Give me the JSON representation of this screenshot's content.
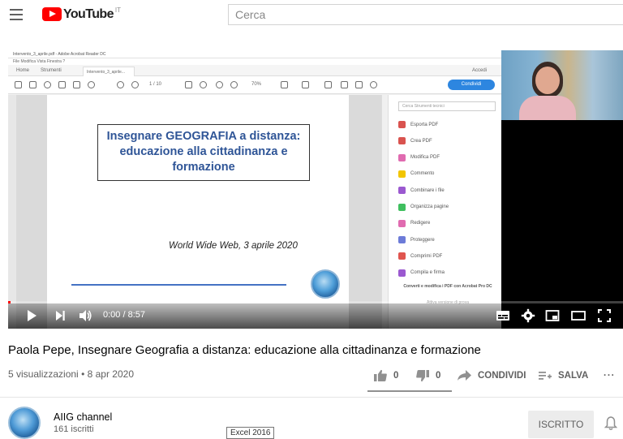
{
  "header": {
    "logo_text": "YouTube",
    "country_code": "IT",
    "search_placeholder": "Cerca"
  },
  "video_frame": {
    "acrobat": {
      "window_title": "Intervento_3_aprile.pdf - Adobe Acrobat Reader DC",
      "menu_items": "File   Modifica   Vista   Finestra   ?",
      "tab_home": "Home",
      "tab_tools": "Strumenti",
      "tab_doc": "Intervento_3_aprile...",
      "signin": "Accedi",
      "share_button": "Condividi",
      "zoom": "70%",
      "page_indicator": "1 / 10",
      "panel_search": "Cerca Strumenti tecnici",
      "panel_items": [
        {
          "label": "Esporta PDF",
          "color": "#d9534f"
        },
        {
          "label": "Crea PDF",
          "color": "#d9534f"
        },
        {
          "label": "Modifica PDF",
          "color": "#e06bb0"
        },
        {
          "label": "Commento",
          "color": "#f2c500"
        },
        {
          "label": "Combinare i file",
          "color": "#9b59d0"
        },
        {
          "label": "Organizza pagine",
          "color": "#3fbf5f"
        },
        {
          "label": "Redigere",
          "color": "#e06bb0"
        },
        {
          "label": "Proteggere",
          "color": "#6c7bd8"
        },
        {
          "label": "Comprimi PDF",
          "color": "#e0554f"
        },
        {
          "label": "Compila e firma",
          "color": "#9b59d0"
        }
      ],
      "panel_footer": "Converti e modifica i PDF con Acrobat Pro DC",
      "panel_footer_link": "Attiva versione di prova"
    },
    "slide": {
      "title": "Insegnare GEOGRAFIA a distanza: educazione alla cittadinanza e formazione",
      "subtitle": "World Wide Web, 3 aprile 2020"
    }
  },
  "player": {
    "time_display": "0:00 / 8:57",
    "progress_fraction": 0.0
  },
  "video": {
    "title": "Paola Pepe, Insegnare Geografia a distanza: educazione alla cittadinanza e formazione",
    "views": "5 visualizzazioni",
    "date": "8 apr 2020",
    "likes": "0",
    "dislikes": "0",
    "share_label": "CONDIVIDI",
    "save_label": "SALVA"
  },
  "channel": {
    "name": "AIIG channel",
    "subscribers": "161 iscritti",
    "subscribe_label": "ISCRITTO"
  },
  "tooltip": "Excel 2016"
}
